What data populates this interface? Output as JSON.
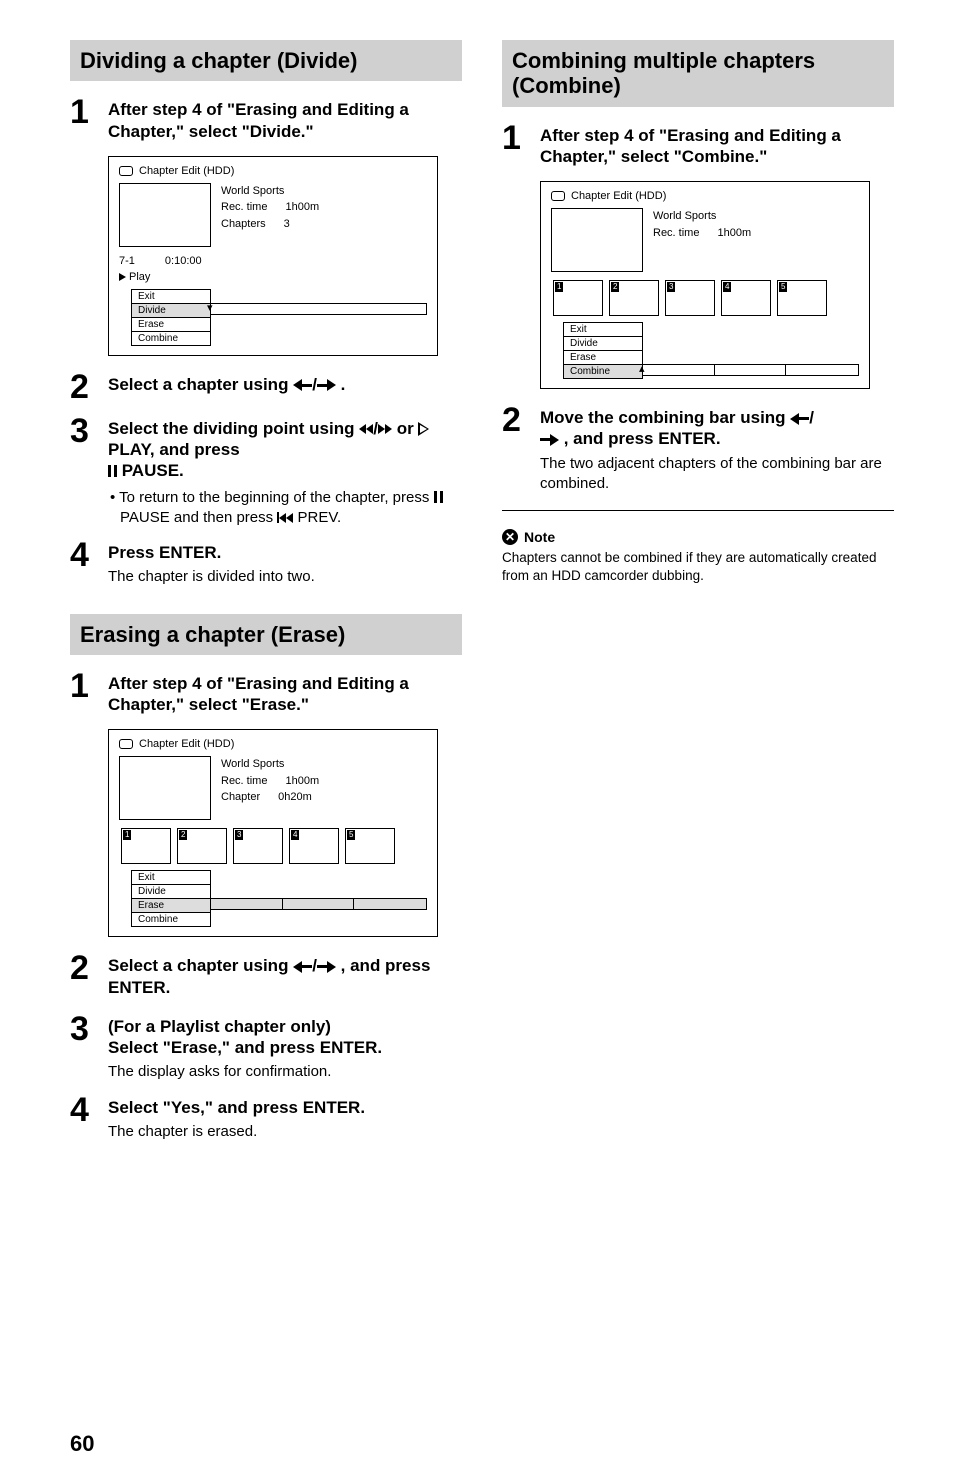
{
  "page_number": "60",
  "left": {
    "section1": {
      "heading": "Dividing a chapter (Divide)",
      "step1": {
        "num": "1",
        "title": "After step 4 of \"Erasing and Editing a Chapter,\" select \"Divide.\""
      },
      "shot": {
        "title": "Chapter Edit (HDD)",
        "program": "World Sports",
        "rec_time_label": "Rec. time",
        "rec_time_value": "1h00m",
        "chapters_label": "Chapters",
        "chapters_value": "3",
        "frame_id": "7-1",
        "timecode": "0:10:00",
        "play": "Play",
        "menu": [
          "Exit",
          "Divide",
          "Erase",
          "Combine"
        ]
      },
      "step2": {
        "num": "2",
        "title_a": "Select a chapter using ",
        "title_b": "."
      },
      "step3": {
        "num": "3",
        "title_a": "Select the dividing point using ",
        "title_b": " or ",
        "title_c": " PLAY, and press ",
        "title_d": " PAUSE.",
        "bullet": "• To return to the beginning of the chapter, press ",
        "bullet_mid": " PAUSE and then press ",
        "bullet_end": " PREV."
      },
      "step4": {
        "num": "4",
        "title": "Press ENTER.",
        "desc": "The chapter is divided into two."
      }
    },
    "section2": {
      "heading": "Erasing a chapter (Erase)",
      "step1": {
        "num": "1",
        "title": "After step 4 of \"Erasing and Editing a Chapter,\" select \"Erase.\""
      },
      "shot": {
        "title": "Chapter Edit (HDD)",
        "program": "World Sports",
        "rec_time_label": "Rec. time",
        "rec_time_value": "1h00m",
        "chapter_label": "Chapter",
        "chapter_value": "0h20m",
        "menu": [
          "Exit",
          "Divide",
          "Erase",
          "Combine"
        ]
      },
      "step2": {
        "num": "2",
        "title_a": "Select a chapter using ",
        "title_b": ", and press ENTER."
      },
      "step3": {
        "num": "3",
        "title_line1": "(For a Playlist chapter only)",
        "title_line2": "Select \"Erase,\" and press ENTER.",
        "desc": "The display asks for confirmation."
      },
      "step4": {
        "num": "4",
        "title": "Select \"Yes,\" and press ENTER.",
        "desc": "The chapter is erased."
      }
    }
  },
  "right": {
    "section1": {
      "heading": "Combining multiple chapters (Combine)",
      "step1": {
        "num": "1",
        "title": "After step 4 of \"Erasing and Editing a Chapter,\" select \"Combine.\""
      },
      "shot": {
        "title": "Chapter Edit (HDD)",
        "program": "World Sports",
        "rec_time_label": "Rec. time",
        "rec_time_value": "1h00m",
        "menu": [
          "Exit",
          "Divide",
          "Erase",
          "Combine"
        ]
      },
      "step2": {
        "num": "2",
        "title_a": "Move the combining bar using ",
        "title_b": ", and press ENTER.",
        "desc": "The two adjacent chapters of the combining bar are combined."
      },
      "note_head": "Note",
      "note_body": "Chapters cannot be combined if they are automatically created from an HDD camcorder dubbing."
    }
  }
}
